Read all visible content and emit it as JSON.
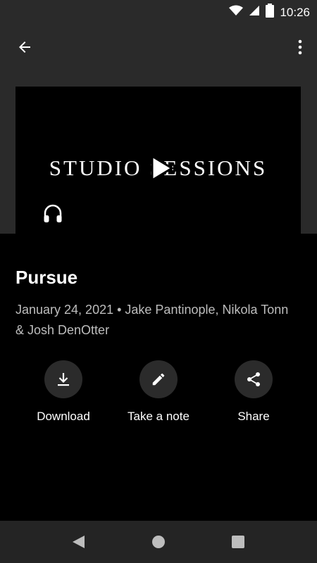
{
  "status_bar": {
    "time": "10:26"
  },
  "artwork": {
    "title": "STUDIO SESSIONS"
  },
  "episode": {
    "title": "Pursue",
    "meta": "January 24, 2021 • Jake Pantinople, Nikola Tonn & Josh DenOtter"
  },
  "actions": {
    "download": "Download",
    "note": "Take a note",
    "share": "Share"
  },
  "icons": [
    "wifi-icon",
    "signal-icon",
    "battery-icon",
    "back-arrow-icon",
    "more-vert-icon",
    "play-icon",
    "headphones-icon",
    "download-icon",
    "pencil-icon",
    "share-icon",
    "nav-back-icon",
    "nav-home-icon",
    "nav-recents-icon"
  ],
  "colors": {
    "background": "#000000",
    "app_bar": "#2a2a2a",
    "meta_text": "#bdbdbd",
    "action_circle": "#2b2b2b"
  }
}
